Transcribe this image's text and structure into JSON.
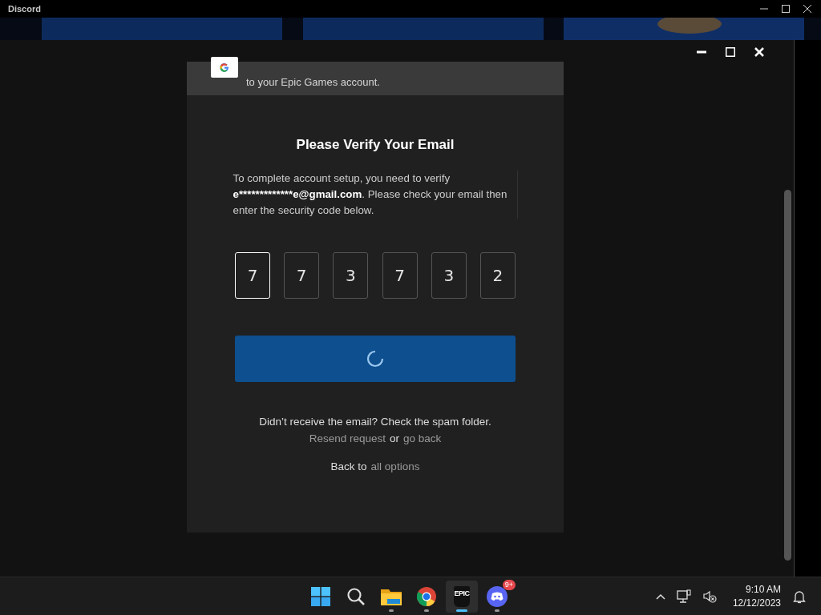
{
  "window": {
    "title": "Discord"
  },
  "banner": {
    "text": "to your Epic Games account."
  },
  "verify": {
    "title": "Please Verify Your Email",
    "message_start": "To complete account setup, you need to verify ",
    "email": "e*************e@gmail.com",
    "message_end": ". Please check your email then enter the security code below."
  },
  "code_digits": [
    {
      "value": "7",
      "selected": true
    },
    {
      "value": "7",
      "selected": false
    },
    {
      "value": "3",
      "selected": false
    },
    {
      "value": "7",
      "selected": false
    },
    {
      "value": "3",
      "selected": false
    },
    {
      "value": "2",
      "selected": false
    }
  ],
  "submit": {
    "loading": true
  },
  "help": {
    "text": "Didn’t receive the email? Check the spam folder.",
    "resend_link": "Resend request",
    "or": "or",
    "back_link": "go back"
  },
  "back": {
    "text": "Back to",
    "link": "all options"
  },
  "taskbar": {
    "apps": [
      {
        "kind": "start",
        "active": false,
        "running": false
      },
      {
        "kind": "search",
        "active": false,
        "running": false
      },
      {
        "kind": "files",
        "active": false,
        "running": true
      },
      {
        "kind": "chrome",
        "active": false,
        "running": true
      },
      {
        "kind": "epic",
        "active": true,
        "running": true,
        "label": "EPIC"
      },
      {
        "kind": "discord",
        "active": false,
        "running": true,
        "badge": "9+"
      }
    ],
    "time": "9:10 AM",
    "date": "12/12/2023"
  }
}
